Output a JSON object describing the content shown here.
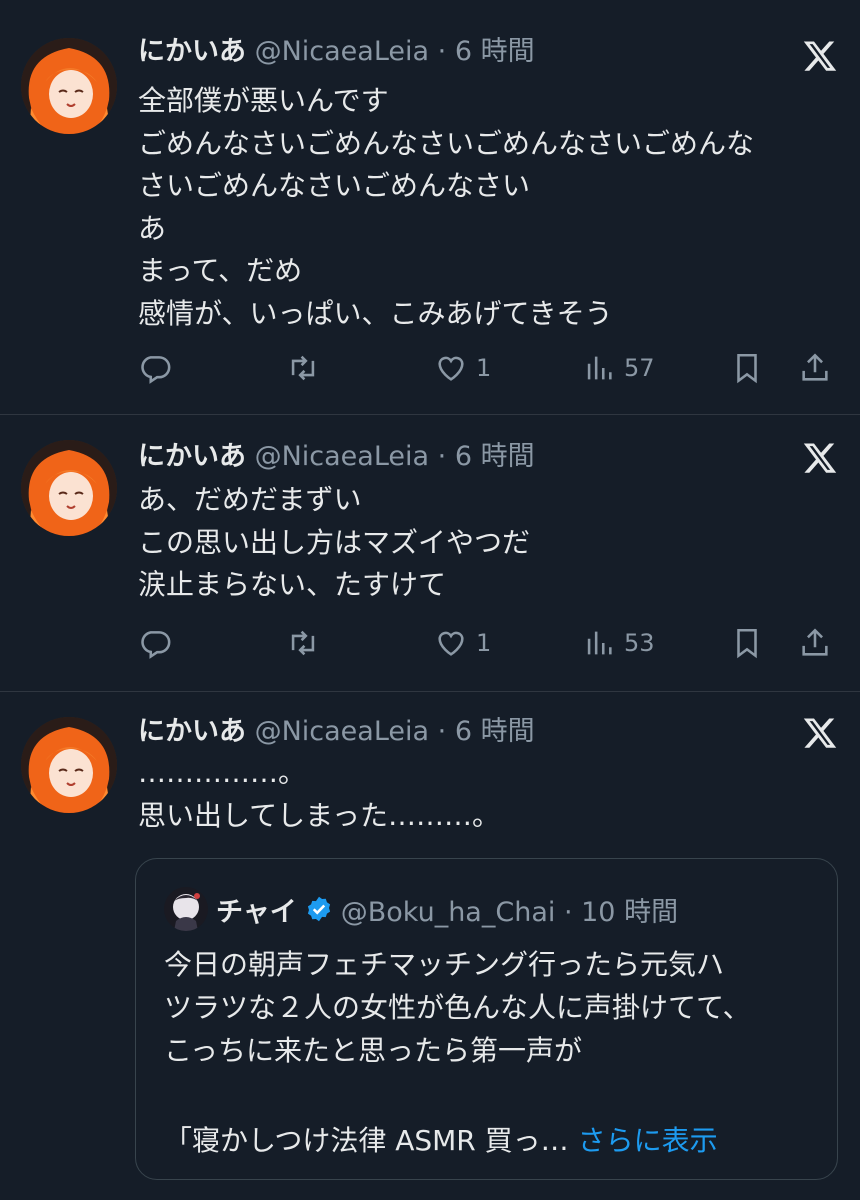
{
  "tweets": [
    {
      "name": "にかいあ",
      "handle": "@NicaeaLeia",
      "time": "6 時間",
      "text": "全部僕が悪いんです\nごめんなさいごめんなさいごめんなさいごめんな\nさいごめんなさいごめんなさい\nあ\nまって、だめ\n感情が、いっぱい、こみあげてきそう",
      "likes": "1",
      "views": "57"
    },
    {
      "name": "にかいあ",
      "handle": "@NicaeaLeia",
      "time": "6 時間",
      "text": "あ、だめだまずい\nこの思い出し方はマズイやつだ\n涙止まらない、たすけて",
      "likes": "1",
      "views": "53"
    },
    {
      "name": "にかいあ",
      "handle": "@NicaeaLeia",
      "time": "6 時間",
      "text": "……………。\n思い出してしまった………。"
    }
  ],
  "quote": {
    "name": "チャイ",
    "handle": "@Boku_ha_Chai",
    "time": "10 時間",
    "text": "今日の朝声フェチマッチング行ったら元気ハ\nツラツな２人の女性が色んな人に声掛けてて、\nこっちに来たと思ったら第一声が",
    "last_line": "「寝かしつけ法律 ASMR 買っ…",
    "show_more": "さらに表示"
  },
  "separator": " · ",
  "colors": {
    "background": "#151d28",
    "text": "#e7e9ea",
    "muted": "#8b98a5",
    "link": "#1d9bf0",
    "verified": "#1d9bf0"
  },
  "icons": [
    "x-logo-icon",
    "reply-icon",
    "retweet-icon",
    "like-icon",
    "views-icon",
    "bookmark-icon",
    "share-icon",
    "verified-badge-icon"
  ]
}
